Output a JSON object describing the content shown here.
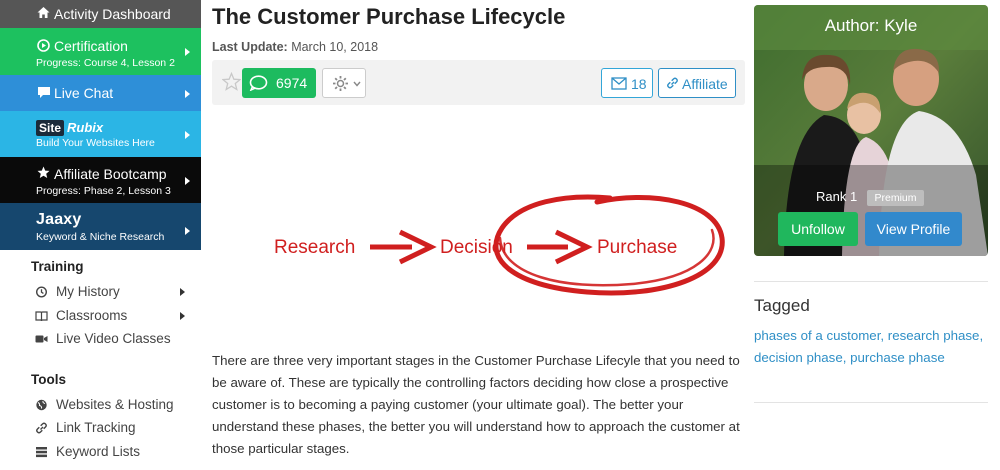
{
  "sidebar": {
    "tiles": [
      {
        "label": "Activity Dashboard",
        "icon": "home-icon"
      },
      {
        "label": "Certification",
        "sub": "Progress: Course 4, Lesson 2",
        "icon": "play-circle-icon"
      },
      {
        "label": "Live Chat",
        "icon": "chat-icon"
      },
      {
        "label": "SiteRubix",
        "sub": "Build Your Websites Here",
        "logo_site": "Site",
        "logo_rubix": "Rubix"
      },
      {
        "label": "Affiliate Bootcamp",
        "sub": "Progress: Phase 2, Lesson 3",
        "icon": "star-icon"
      },
      {
        "label": "Jaaxy",
        "sub": "Keyword & Niche Research",
        "logo": "Jaaxy"
      }
    ],
    "training": {
      "heading": "Training",
      "items": [
        {
          "label": "My History",
          "icon": "history-icon"
        },
        {
          "label": "Classrooms",
          "icon": "book-icon"
        },
        {
          "label": "Live Video Classes",
          "icon": "video-camera-icon"
        }
      ]
    },
    "tools": {
      "heading": "Tools",
      "items": [
        {
          "label": "Websites & Hosting",
          "icon": "globe-icon"
        },
        {
          "label": "Link Tracking",
          "icon": "link-icon"
        },
        {
          "label": "Keyword Lists",
          "icon": "list-icon"
        }
      ]
    }
  },
  "article": {
    "title": "The Customer Purchase Lifecycle",
    "updated_label": "Last Update:",
    "updated_date": "March 10, 2018",
    "comments_count": "6974",
    "messages_count": "18",
    "affiliate_label": "Affiliate",
    "diagram": {
      "research": "Research",
      "decision": "Decision",
      "purchase": "Purchase",
      "accent": "#d01f1f"
    },
    "body": "There are three very important stages in the Customer Purchase Lifecyle that you need to be aware of. These are typically the controlling factors deciding how close a prospective customer is to becoming a paying customer (your ultimate goal). The better your understand these phases, the better you will understand how to approach the customer at those particular stages."
  },
  "author": {
    "heading": "Author: Kyle",
    "rank": "Rank 1",
    "badge": "Premium",
    "unfollow_label": "Unfollow",
    "view_profile_label": "View Profile"
  },
  "tagged": {
    "heading": "Tagged",
    "tags": [
      "phases of a customer",
      "research phase",
      "decision phase",
      "purchase phase"
    ]
  },
  "colors": {
    "green": "#1dbb5f",
    "blue": "#2f8fc6",
    "red": "#d01f1f"
  }
}
